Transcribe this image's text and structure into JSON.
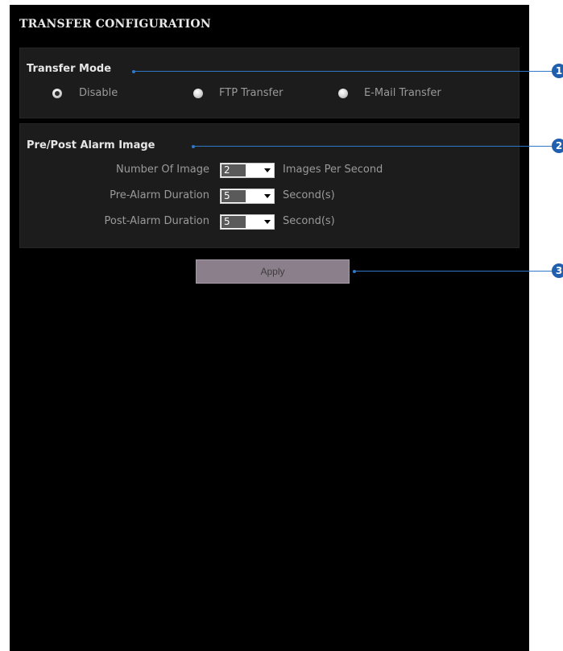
{
  "title": "TRANSFER CONFIGURATION",
  "transfer_mode": {
    "heading": "Transfer Mode",
    "options": [
      {
        "label": "Disable",
        "checked": true
      },
      {
        "label": "FTP Transfer",
        "checked": false
      },
      {
        "label": "E-Mail Transfer",
        "checked": false
      }
    ]
  },
  "alarm_image": {
    "heading": "Pre/Post Alarm Image",
    "rows": [
      {
        "label": "Number Of Image",
        "value": "2",
        "unit": "Images Per Second"
      },
      {
        "label": "Pre-Alarm Duration",
        "value": "5",
        "unit": "Second(s)"
      },
      {
        "label": "Post-Alarm Duration",
        "value": "5",
        "unit": "Second(s)"
      }
    ]
  },
  "apply_label": "Apply",
  "callouts": [
    "1",
    "2",
    "3"
  ],
  "colors": {
    "callout": "#1f5fae",
    "leader": "#2e78c8",
    "apply_button": "#8a7f8a"
  }
}
